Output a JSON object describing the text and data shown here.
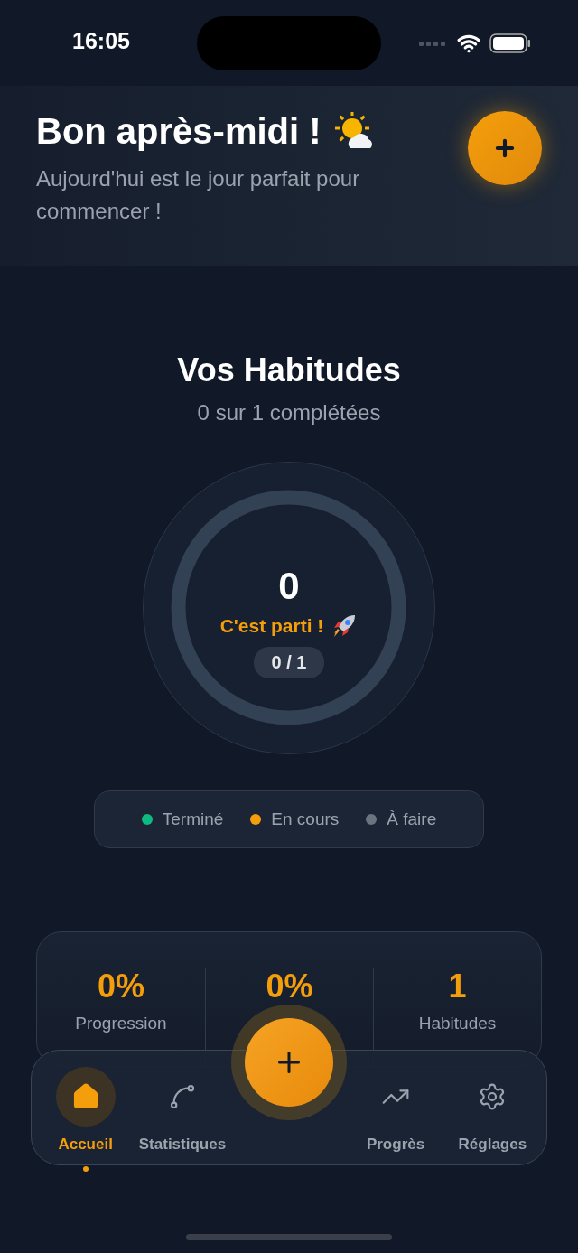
{
  "status_bar": {
    "time": "16:05"
  },
  "header": {
    "title": "Bon après-midi !",
    "subtitle": "Aujourd'hui est le jour parfait pour commencer !"
  },
  "summary": {
    "title": "Vos Habitudes",
    "subtitle": "0 sur 1 complétées",
    "count": "0",
    "message": "C'est parti !",
    "ratio": "0 / 1"
  },
  "legend": [
    {
      "label": "Terminé",
      "color": "#10b981"
    },
    {
      "label": "En cours",
      "color": "#f59e0b"
    },
    {
      "label": "À faire",
      "color": "#6b7280"
    }
  ],
  "stats": [
    {
      "value": "0%",
      "label": "Progression"
    },
    {
      "value": "0%"
    },
    {
      "value": "1",
      "label": "Habitudes"
    }
  ],
  "nav": [
    {
      "label": "Accueil",
      "selected": true
    },
    {
      "label": "Statistiques",
      "selected": false
    },
    {
      "label": "Progrès",
      "selected": false
    },
    {
      "label": "Réglages",
      "selected": false
    }
  ]
}
